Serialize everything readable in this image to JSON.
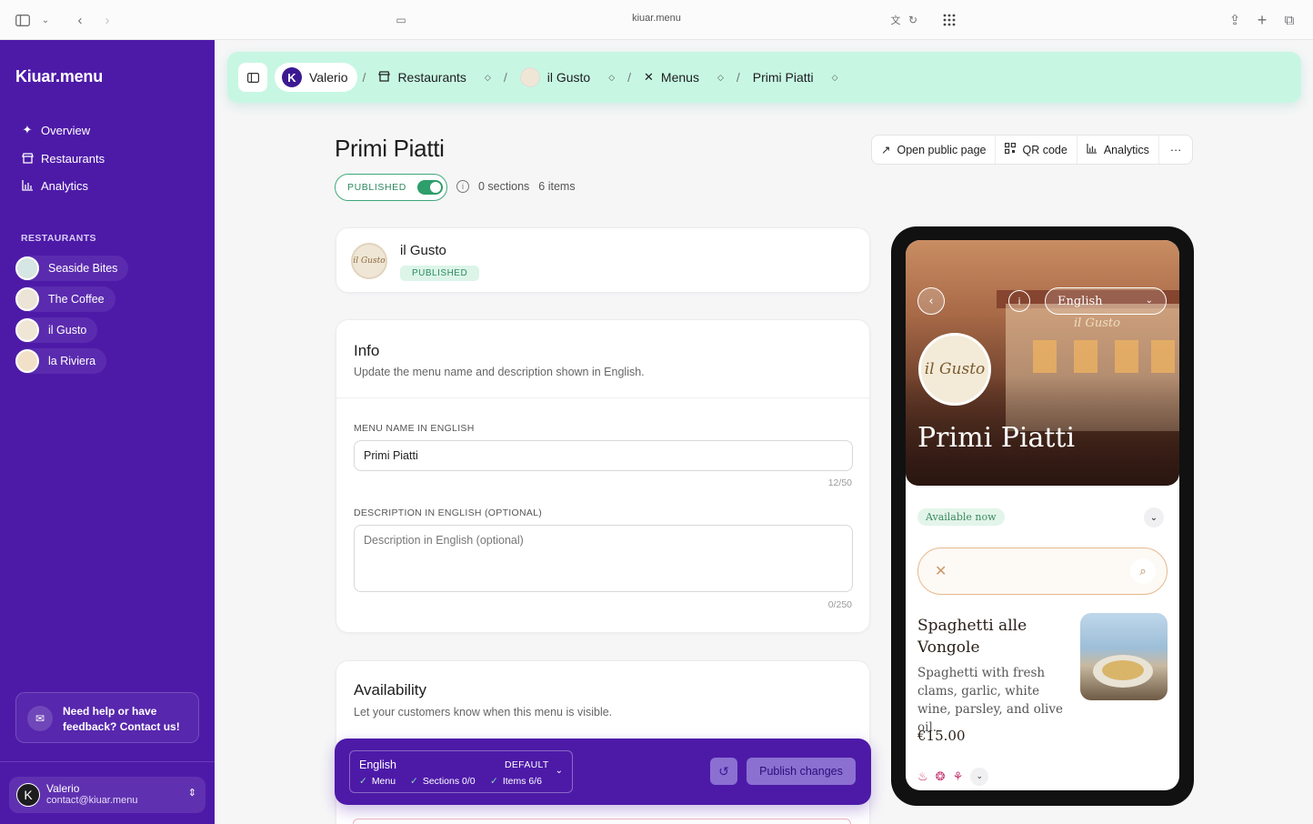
{
  "browser": {
    "url": "kiuar.menu"
  },
  "sidebar": {
    "logo": "Kiuar.menu",
    "nav": [
      {
        "label": "Overview",
        "icon": "sparkle-icon"
      },
      {
        "label": "Restaurants",
        "icon": "store-icon"
      },
      {
        "label": "Analytics",
        "icon": "bar-chart-icon"
      }
    ],
    "restaurants_label": "RESTAURANTS",
    "restaurants": [
      {
        "name": "Seaside Bites"
      },
      {
        "name": "The Coffee"
      },
      {
        "name": "il Gusto"
      },
      {
        "name": "la Riviera"
      }
    ],
    "help_text": "Need help or have feedback? Contact us!",
    "user": {
      "initial": "K",
      "name": "Valerio",
      "email": "contact@kiuar.menu"
    }
  },
  "breadcrumb": {
    "user": {
      "initial": "K",
      "label": "Valerio"
    },
    "items": [
      {
        "label": "Restaurants"
      },
      {
        "label": "il Gusto"
      },
      {
        "label": "Menus"
      },
      {
        "label": "Primi Piatti"
      }
    ],
    "separator": "/"
  },
  "page": {
    "title": "Primi Piatti",
    "status": "PUBLISHED",
    "published": true,
    "sections_count": "0 sections",
    "items_count": "6 items",
    "actions": [
      {
        "label": "Open public page",
        "icon": "external-link-icon"
      },
      {
        "label": "QR code",
        "icon": "qr-code-icon"
      },
      {
        "label": "Analytics",
        "icon": "bar-chart-icon"
      }
    ],
    "more": "···"
  },
  "restaurant_card": {
    "name": "il Gusto",
    "badge": "PUBLISHED",
    "logo_text": "il Gusto"
  },
  "info_card": {
    "title": "Info",
    "subtitle": "Update the menu name and description shown in English.",
    "name_label": "MENU NAME IN ENGLISH",
    "name_value": "Primi Piatti",
    "name_counter": "12/50",
    "desc_label": "DESCRIPTION IN ENGLISH (OPTIONAL)",
    "desc_placeholder": "Description in English (optional)",
    "desc_counter": "0/250"
  },
  "availability_card": {
    "title": "Availability",
    "subtitle": "Let your customers know when this menu is visible."
  },
  "publish_bar": {
    "language": "English",
    "default_label": "DEFAULT",
    "checks": [
      {
        "label": "Menu"
      },
      {
        "label": "Sections 0/0"
      },
      {
        "label": "Items 6/6"
      }
    ],
    "publish_label": "Publish changes"
  },
  "preview": {
    "language": "English",
    "sign": "il Gusto",
    "logo_text": "il Gusto",
    "title": "Primi Piatti",
    "availability": "Available now",
    "dish": {
      "name": "Spaghetti alle Vongole",
      "description": "Spaghetti with fresh clams, garlic, white wine, parsley, and olive oil.",
      "price": "€15.00"
    }
  },
  "colors": {
    "sidebar": "#4d1aa8",
    "breadcrumb_bg": "#c7f7e3",
    "success": "#2e9e6a"
  }
}
